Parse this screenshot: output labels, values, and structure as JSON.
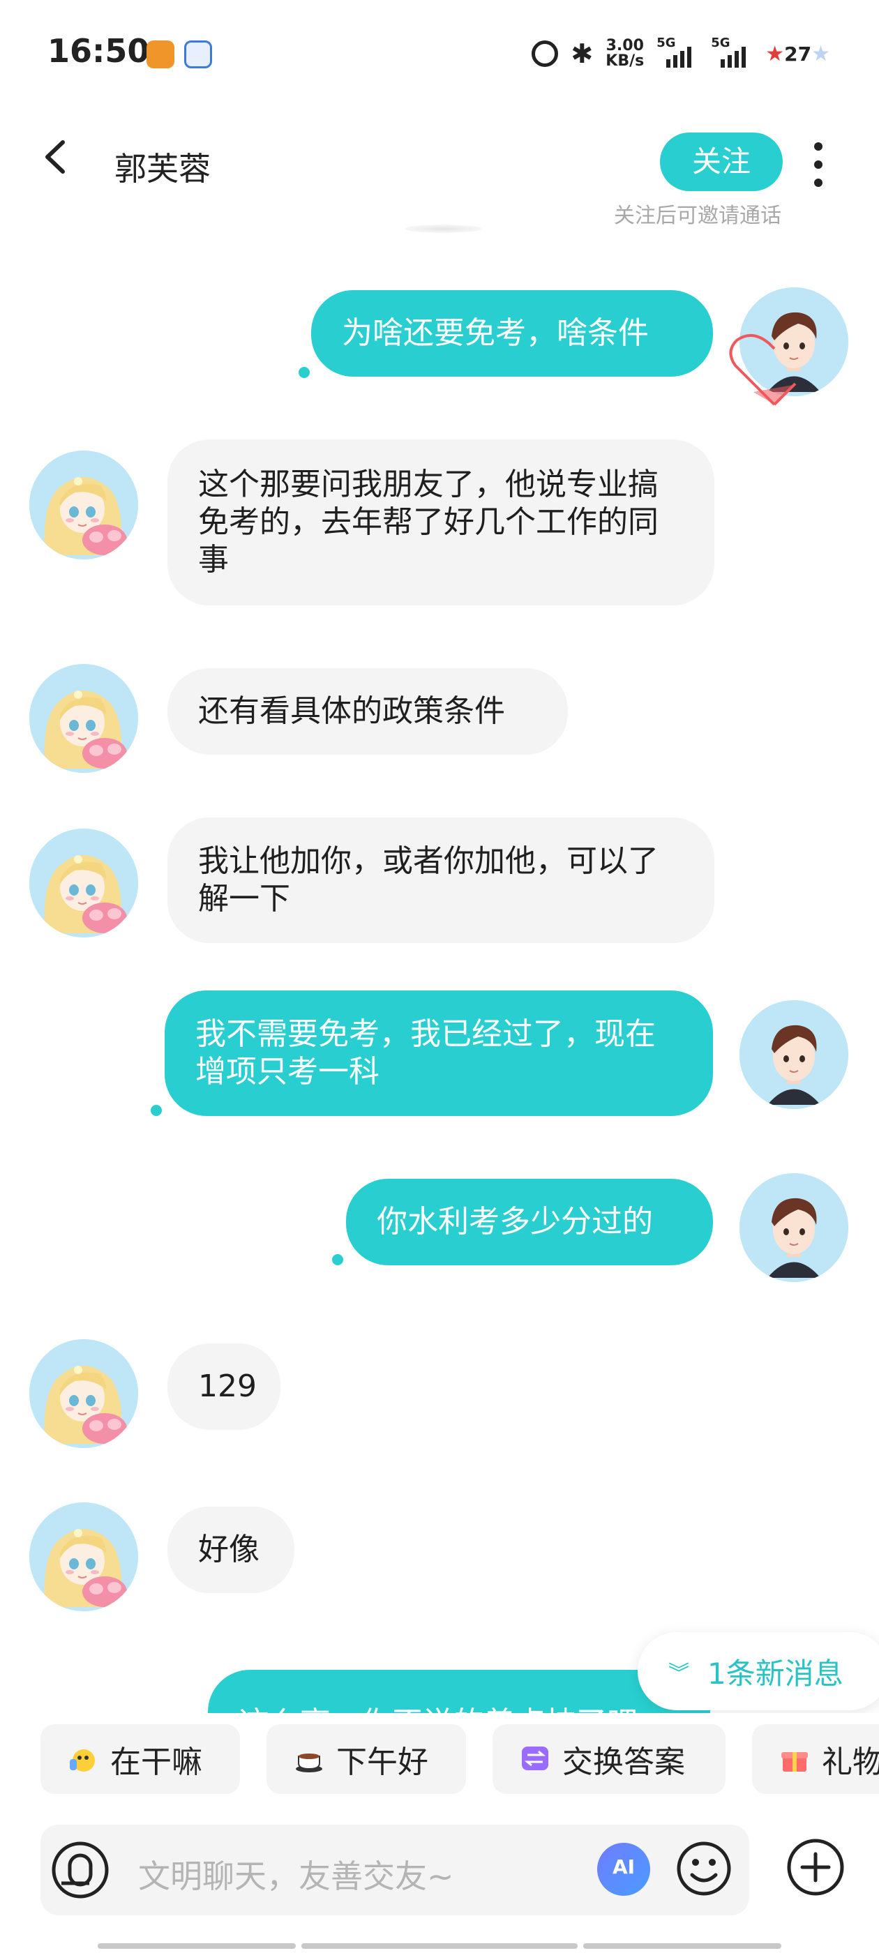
{
  "status_bar": {
    "time": "16:50",
    "net_speed_value": "3.00",
    "net_speed_unit": "KB/s",
    "sim1": "5G",
    "sim2": "5G",
    "battery": "27"
  },
  "header": {
    "contact_name": "郭芙蓉",
    "follow_label": "关注",
    "follow_hint": "关注后可邀请通话"
  },
  "messages": [
    {
      "side": "me",
      "text": "为啥还要免考，啥条件"
    },
    {
      "side": "other",
      "text": "这个那要问我朋友了，他说专业搞免考的，去年帮了好几个工作的同事"
    },
    {
      "side": "other",
      "text": "还有看具体的政策条件"
    },
    {
      "side": "other",
      "text": "我让他加你，或者你加他，可以了解一下"
    },
    {
      "side": "me",
      "text": "我不需要免考，我已经过了，现在增项只考一科"
    },
    {
      "side": "me",
      "text": "你水利考多少分过的"
    },
    {
      "side": "other",
      "text": "129"
    },
    {
      "side": "other",
      "text": "好像"
    }
  ],
  "partial_message": "这么高，你不说的着点技了吧",
  "new_message_label": "1条新消息",
  "quick_replies": [
    {
      "label": "在干嘛",
      "icon": "waving-face-icon"
    },
    {
      "label": "下午好",
      "icon": "coffee-cup-icon"
    },
    {
      "label": "交换答案",
      "icon": "swap-icon"
    },
    {
      "label": "礼物",
      "icon": "gift-icon"
    }
  ],
  "input": {
    "placeholder": "文明聊天，友善交友~",
    "ai_label": "AI"
  },
  "colors": {
    "accent": "#29cfd0",
    "bubble_other": "#f4f4f4"
  }
}
